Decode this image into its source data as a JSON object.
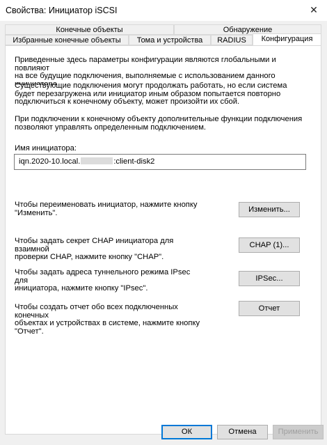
{
  "window": {
    "title": "Свойства: Инициатор iSCSI",
    "close_glyph": "✕"
  },
  "tabs_row1": [
    "Конечные объекты",
    "Обнаружение"
  ],
  "tabs_row2": [
    "Избранные конечные объекты",
    "Тома и устройства",
    "RADIUS",
    "Конфигурация"
  ],
  "intro": {
    "lines": [
      "Приведенные здесь параметры конфигурации являются глобальными и повлияют",
      "на все будущие подключения, выполняемые с использованием данного",
      "инициатора."
    ]
  },
  "existing": {
    "lines": [
      "Существующие подключения могут продолжать работать, но если система",
      "будет перезагружена или инициатор иным образом попытается повторно",
      "подключиться к конечному объекту, может произойти их сбой."
    ]
  },
  "connect": {
    "lines": [
      "При подключении к конечному объекту дополнительные функции подключения",
      "позволяют управлять определенным подключением."
    ]
  },
  "initiator": {
    "label": "Имя инициатора:",
    "value_prefix": "iqn.2020-10.local.",
    "value_suffix": ":client-disk2"
  },
  "rename": {
    "lines": [
      "Чтобы переименовать инициатор, нажмите кнопку",
      "\"Изменить\"."
    ],
    "button": "Изменить..."
  },
  "chap": {
    "lines": [
      "Чтобы задать секрет CHAP инициатора для взаимной",
      "проверки CHAP, нажмите кнопку \"CHAP\"."
    ],
    "button": "CHAP (1)..."
  },
  "ipsec": {
    "lines": [
      "Чтобы задать адреса туннельного режима IPsec для",
      "инициатора, нажмите кнопку \"IPsec\"."
    ],
    "button": "IPSec..."
  },
  "report": {
    "lines": [
      "Чтобы создать отчет обо всех подключенных конечных",
      "объектах и устройствах в системе, нажмите кнопку",
      "\"Отчет\"."
    ],
    "button": "Отчет"
  },
  "footer": {
    "ok": "ОК",
    "cancel": "Отмена",
    "apply": "Применить"
  }
}
